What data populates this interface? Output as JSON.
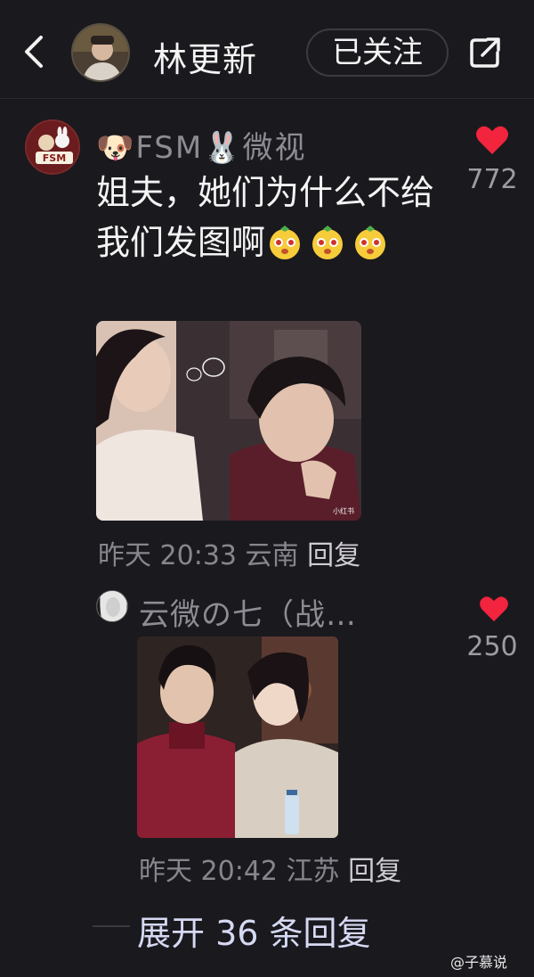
{
  "header": {
    "name": "林更新",
    "follow_label": "已关注"
  },
  "comment": {
    "username": "🐶FSM🐰微视",
    "text": "姐夫，她们为什么不给我们发图啊",
    "avatar_text": "FSM",
    "likes": "772",
    "time": "昨天 20:33",
    "location": "云南",
    "reply_label": "回复",
    "image_watermark": "小红书"
  },
  "reply": {
    "username": "云微の七（战…",
    "likes": "250",
    "time": "昨天 20:42",
    "location": "江苏",
    "reply_label": "回复"
  },
  "expand_label": "展开 36 条回复",
  "watermark": "@子慕说",
  "colors": {
    "background": "#1a191e",
    "like": "#f2243e",
    "muted_text": "#88868d",
    "expand_text": "#d6d9f2"
  },
  "icons": [
    "back-icon",
    "share-icon",
    "heart-icon",
    "emoji-icon"
  ]
}
